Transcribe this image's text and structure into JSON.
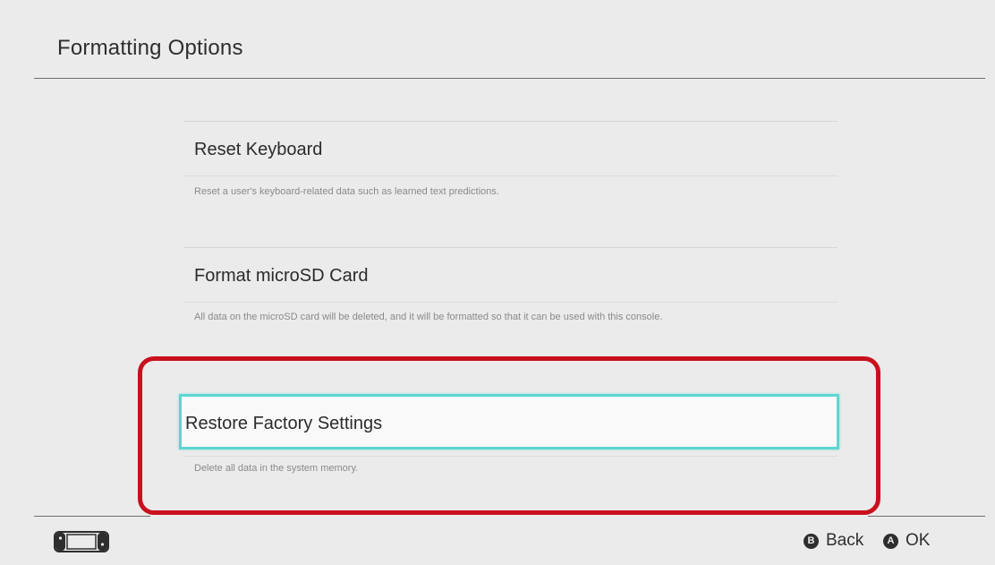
{
  "header": {
    "title": "Formatting Options"
  },
  "options": [
    {
      "title": "Reset Keyboard",
      "description": "Reset a user's keyboard-related data such as learned text predictions."
    },
    {
      "title": "Format microSD Card",
      "description": "All data on the microSD card will be deleted, and it will be formatted so that it can be used with this console."
    },
    {
      "title": "Restore Factory Settings",
      "description": "Delete all data in the system memory.",
      "selected": true
    }
  ],
  "footer": {
    "console_icon": "handheld-console-icon",
    "back_glyph": "B",
    "back_label": "Back",
    "ok_glyph": "A",
    "ok_label": "OK"
  },
  "colors": {
    "background": "#ebebeb",
    "selection_border": "#5ed6d2",
    "annotation_highlight": "#c8101e"
  }
}
